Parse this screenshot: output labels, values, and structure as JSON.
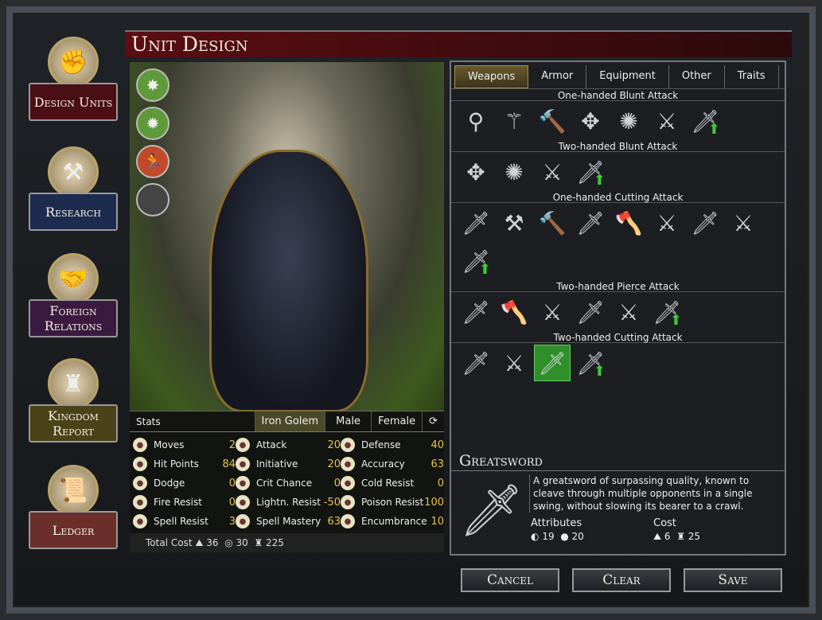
{
  "title": "Unit Design",
  "sidebar": [
    {
      "label": "Design Units",
      "icon": "fist-icon",
      "color": "#4a0f14"
    },
    {
      "label": "Research",
      "icon": "compass-icon",
      "color": "#1d2b4f"
    },
    {
      "label": "Foreign Relations",
      "icon": "handshake-icon",
      "color": "#3a1a3e"
    },
    {
      "label": "Kingdom Report",
      "icon": "castle-icon",
      "color": "#4a4218"
    },
    {
      "label": "Ledger",
      "icon": "scroll-icon",
      "color": "#6a2f2a"
    }
  ],
  "badges": [
    {
      "icon": "spider-icon",
      "color": "#5f9a3a"
    },
    {
      "icon": "star-burst-icon",
      "color": "#5f9a3a"
    },
    {
      "icon": "running-figure-icon",
      "color": "#c24a2a"
    },
    {
      "icon": "empty-slot-icon",
      "color": "#444"
    }
  ],
  "stats": {
    "header": "Stats",
    "tabs": [
      "Iron Golem",
      "Male",
      "Female"
    ],
    "rows": [
      {
        "label": "Moves",
        "value": "2"
      },
      {
        "label": "Attack",
        "value": "20"
      },
      {
        "label": "Defense",
        "value": "40"
      },
      {
        "label": "Hit Points",
        "value": "84"
      },
      {
        "label": "Initiative",
        "value": "20"
      },
      {
        "label": "Accuracy",
        "value": "63"
      },
      {
        "label": "Dodge",
        "value": "0"
      },
      {
        "label": "Crit Chance",
        "value": "0"
      },
      {
        "label": "Cold Resist",
        "value": "0"
      },
      {
        "label": "Fire Resist",
        "value": "0"
      },
      {
        "label": "Lightn. Resist",
        "value": "-50"
      },
      {
        "label": "Poison Resist",
        "value": "100"
      },
      {
        "label": "Spell Resist",
        "value": "3"
      },
      {
        "label": "Spell Mastery",
        "value": "63"
      },
      {
        "label": "Encumbrance",
        "value": "10"
      }
    ],
    "total_label": "Total Cost",
    "total": [
      "36",
      "30",
      "225"
    ]
  },
  "tabs": [
    "Weapons",
    "Armor",
    "Equipment",
    "Other",
    "Traits"
  ],
  "categories": [
    {
      "name": "One-handed Blunt Attack",
      "count": 7
    },
    {
      "name": "Two-handed Blunt Attack",
      "count": 4
    },
    {
      "name": "One-handed Cutting Attack",
      "count": 9
    },
    {
      "name": "Two-handed Pierce Attack",
      "count": 6
    },
    {
      "name": "Two-handed Cutting Attack",
      "count": 4,
      "selected": 2
    }
  ],
  "item": {
    "name": "Greatsword",
    "description": "A greatsword of surpassing quality, known to cleave through multiple opponents in a single swing, without slowing its bearer to a crawl.",
    "attributes_label": "Attributes",
    "attributes": [
      "19",
      "20"
    ],
    "cost_label": "Cost",
    "cost": [
      "6",
      "25"
    ]
  },
  "buttons": {
    "cancel": "Cancel",
    "clear": "Clear",
    "save": "Save"
  }
}
